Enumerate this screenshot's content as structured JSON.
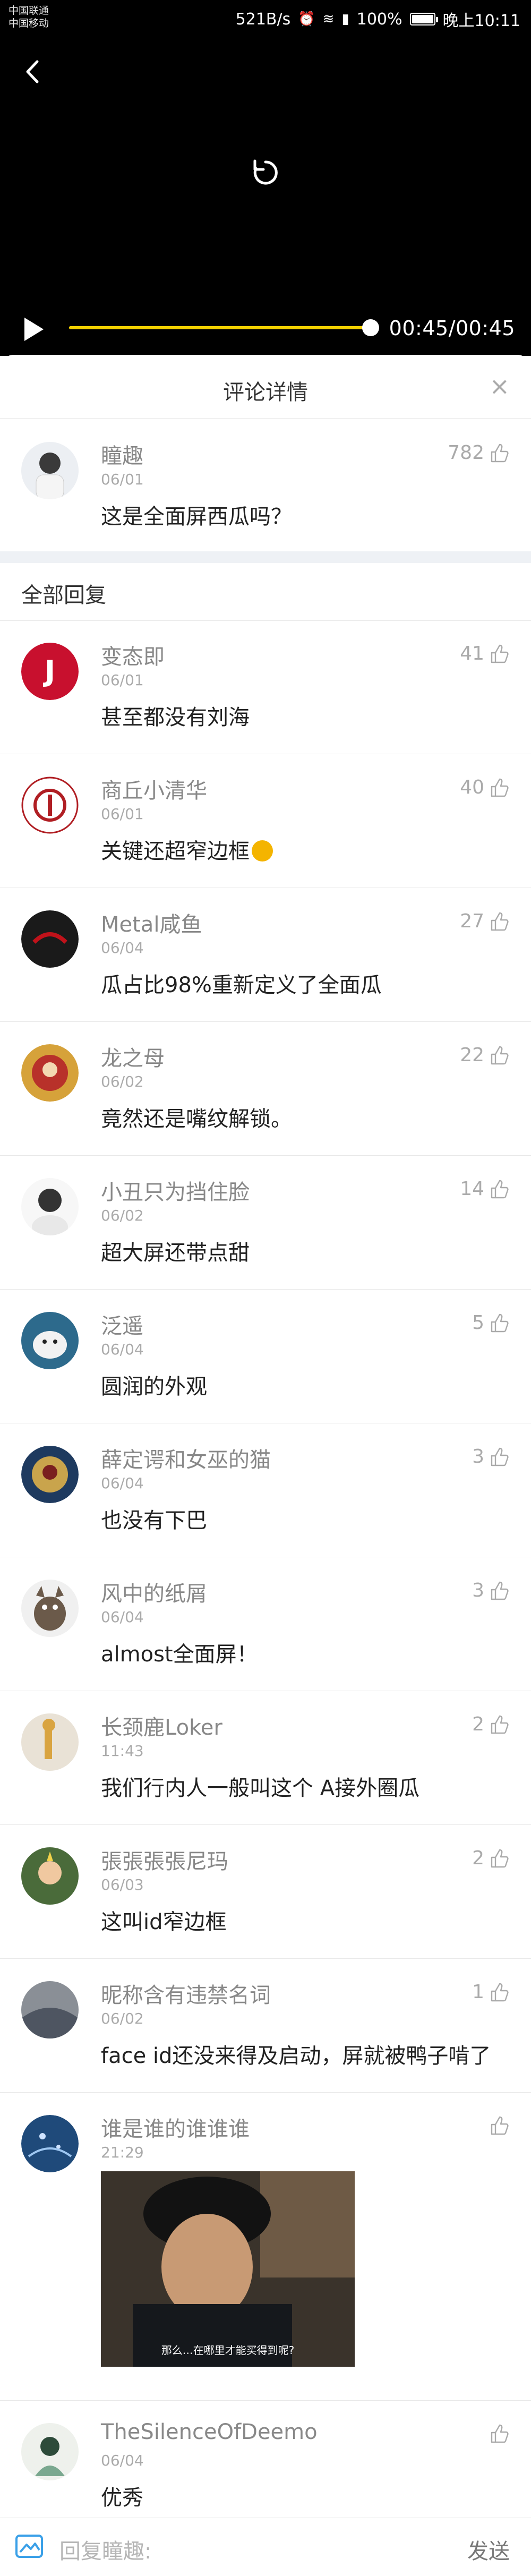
{
  "status_bar": {
    "carrier_1": "中国联通",
    "carrier_2": "中国移动",
    "speed": "521B/s",
    "battery": "100%",
    "time": "晚上10:11"
  },
  "player": {
    "time_text": "00:45/00:45",
    "progress": 1.0
  },
  "sheet": {
    "title": "评论详情",
    "close_label": "×",
    "all_replies_label": "全部回复"
  },
  "op": {
    "username": "瞳趣",
    "date": "06/01",
    "text": "这是全面屏西瓜吗？",
    "likes": "782"
  },
  "replies": [
    {
      "username": "变态即",
      "date": "06/01",
      "text": "甚至都没有刘海",
      "likes": "41"
    },
    {
      "username": "商丘小清华",
      "date": "06/01",
      "text": "关键还超窄边框",
      "likes": "40"
    },
    {
      "username": "Metal咸鱼",
      "date": "06/04",
      "text": "瓜占比98%重新定义了全面瓜",
      "likes": "27"
    },
    {
      "username": "龙之母",
      "date": "06/02",
      "text": "竟然还是嘴纹解锁。",
      "likes": "22"
    },
    {
      "username": "小丑只为挡住脸",
      "date": "06/02",
      "text": "超大屏还带点甜",
      "likes": "14"
    },
    {
      "username": "泛遥",
      "date": "06/04",
      "text": "圆润的外观",
      "likes": "5"
    },
    {
      "username": "薛定谔和女巫的猫",
      "date": "06/04",
      "text": "也没有下巴",
      "likes": "3"
    },
    {
      "username": "风中的纸屑",
      "date": "06/04",
      "text": "almost全面屏！",
      "likes": "3"
    },
    {
      "username": "长颈鹿Loker",
      "date": "11:43",
      "text": "我们行内人一般叫这个 A接外圈瓜",
      "likes": "2"
    },
    {
      "username": "張張張張尼玛",
      "date": "06/03",
      "text": "这叫id窄边框",
      "likes": "2"
    },
    {
      "username": "昵称含有违禁名词",
      "date": "06/02",
      "text": "face id还没来得及启动，屏就被鸭子啃了",
      "likes": "1"
    },
    {
      "username": "谁是谁的谁谁谁",
      "date": "21:29",
      "text": "",
      "likes": "",
      "image_caption": "那么…在哪里才能买得到呢?"
    },
    {
      "username": "TheSilenceOfDeemo",
      "date": "06/04",
      "text": "优秀",
      "likes": ""
    }
  ],
  "reply_bar": {
    "placeholder": "回复瞳趣:",
    "send_label": "发送"
  },
  "colors": {
    "accent_progress": "#f5d000",
    "separator": "#eef1f5",
    "reply_icon": "#3aa0e8"
  }
}
